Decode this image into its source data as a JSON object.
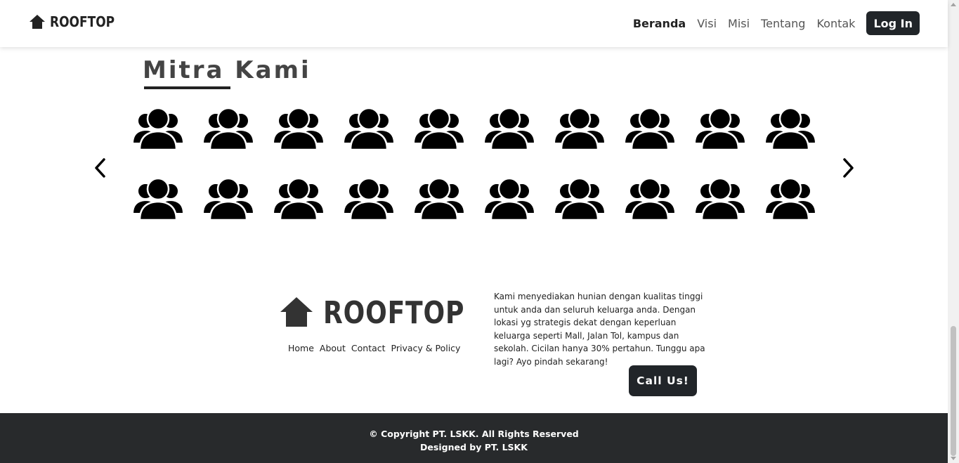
{
  "brand": {
    "name": "ROOFTOP",
    "icon": "house-icon"
  },
  "nav": {
    "items": [
      {
        "label": "Beranda",
        "active": true
      },
      {
        "label": "Visi",
        "active": false
      },
      {
        "label": "Misi",
        "active": false
      },
      {
        "label": "Tentang",
        "active": false
      },
      {
        "label": "Kontak",
        "active": false
      }
    ],
    "login_label": "Log In"
  },
  "partners": {
    "title": "Mitra Kami",
    "icon": "users-icon",
    "rows": 2,
    "per_row": 10,
    "prev_icon": "chevron-left-icon",
    "next_icon": "chevron-right-icon"
  },
  "footer": {
    "brand_name": "ROOFTOP",
    "links": [
      "Home",
      "About",
      "Contact",
      "Privacy & Policy"
    ],
    "description": "Kami menyediakan hunian dengan kualitas tinggi untuk anda dan seluruh keluarga anda. Dengan lokasi yg strategis dekat dengan keperluan keluarga seperti Mall, Jalan Tol, kampus dan sekolah. Cicilan hanya 30% pertahun. Tunggu apa lagi? Ayo pindah sekarang!",
    "call_label": "Call Us!"
  },
  "bottom": {
    "copyright": "© Copyright PT. LSKK. All Rights Reserved",
    "designed": "Designed by PT. LSKK"
  },
  "colors": {
    "dark": "#212529",
    "footer_bg": "#282a2c"
  }
}
